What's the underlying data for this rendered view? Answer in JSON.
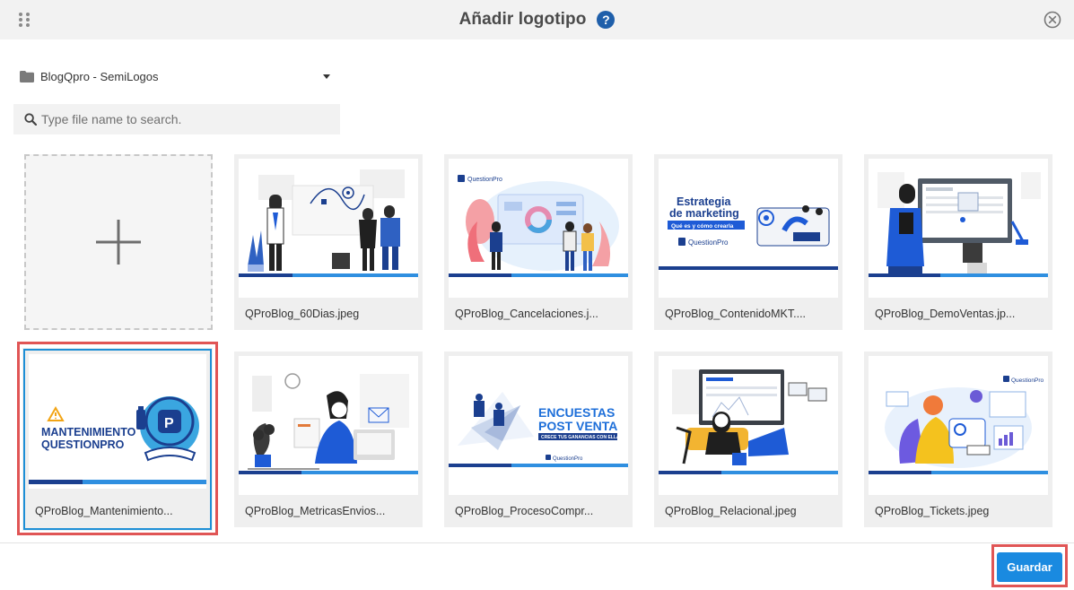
{
  "header": {
    "title": "Añadir logotipo",
    "help_glyph": "?",
    "icons": [
      "drag-handle-icon",
      "help-icon",
      "close-circle-icon"
    ]
  },
  "folder": {
    "label": "BlogQpro - SemiLogos",
    "icon": "folder-icon"
  },
  "search": {
    "placeholder": "Type file name to search.",
    "value": ""
  },
  "add_tile": {
    "icon": "plus-icon"
  },
  "files": [
    {
      "name": "QProBlog_60Dias.jpeg",
      "selected": false
    },
    {
      "name": "QProBlog_Cancelaciones.j...",
      "selected": false,
      "thumb_text": [
        "QuestionPro"
      ]
    },
    {
      "name": "QProBlog_ContenidoMKT....",
      "selected": false,
      "thumb_text": [
        "Estrategia",
        "de marketing",
        "Qué es y cómo crearla",
        "QuestionPro"
      ]
    },
    {
      "name": "QProBlog_DemoVentas.jp...",
      "selected": false
    },
    {
      "name": "QProBlog_Mantenimiento...",
      "selected": true,
      "thumb_text": [
        "MANTENIMIENTO",
        "QUESTIONPRO"
      ]
    },
    {
      "name": "QProBlog_MetricasEnvios...",
      "selected": false
    },
    {
      "name": "QProBlog_ProcesoCompr...",
      "selected": false,
      "thumb_text": [
        "ENCUESTAS",
        "POST VENTA",
        "CRECE TUS GANANCIAS CON ELLAS",
        "QuestionPro"
      ]
    },
    {
      "name": "QProBlog_Relacional.jpeg",
      "selected": false
    },
    {
      "name": "QProBlog_Tickets.jpeg",
      "selected": false,
      "thumb_text": [
        "QuestionPro"
      ]
    }
  ],
  "footer": {
    "save_label": "Guardar"
  },
  "colors": {
    "accent": "#1a8ae0",
    "brand_navy": "#1b3f8f",
    "highlight_red": "#e05555",
    "selection_blue": "#1d8fd6"
  }
}
